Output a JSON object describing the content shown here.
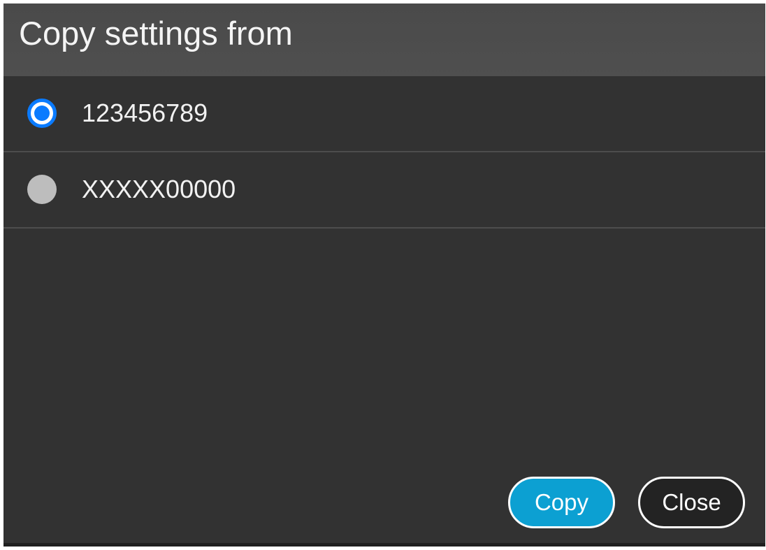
{
  "dialog": {
    "title": "Copy settings from",
    "options": [
      {
        "label": "123456789",
        "selected": true
      },
      {
        "label": "XXXXX00000",
        "selected": false
      }
    ],
    "buttons": {
      "copy_label": "Copy",
      "close_label": "Close"
    }
  },
  "colors": {
    "dialog_bg": "#323232",
    "header_bg": "#4d4d4d",
    "radio_selected": "#0a7bff",
    "radio_unselected": "#bdbdbd",
    "copy_button_bg": "#0ca0d2",
    "close_button_bg": "#232323"
  }
}
